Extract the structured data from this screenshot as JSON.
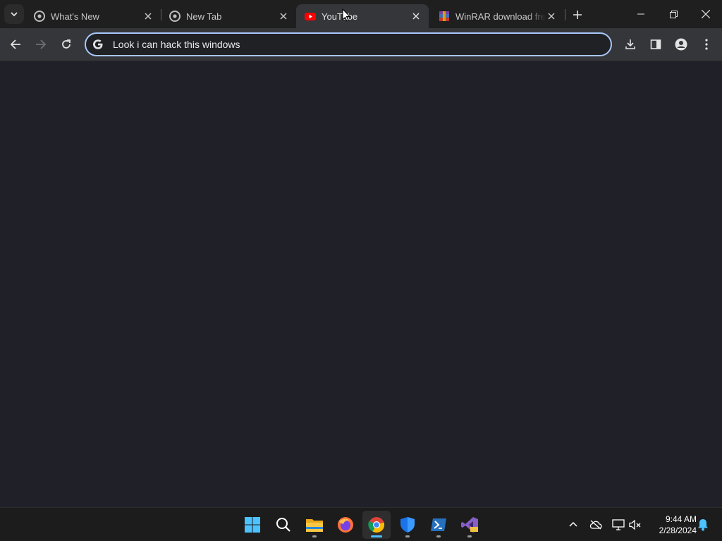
{
  "browser": {
    "tabs": [
      {
        "title": "What's New",
        "icon": "chrome-icon"
      },
      {
        "title": "New Tab",
        "icon": "chrome-icon"
      },
      {
        "title": "YouTube",
        "icon": "youtube-icon",
        "active": true
      },
      {
        "title": "WinRAR download fre",
        "icon": "winrar-icon"
      }
    ],
    "omnibox": {
      "value": "Look i can hack this windows"
    },
    "accent_color": "#a8c7fa",
    "content_background": "#1f2028"
  },
  "taskbar": {
    "apps": [
      "windows-start-icon",
      "search-icon",
      "file-explorer-icon",
      "firefox-icon",
      "chrome-icon",
      "windows-security-icon",
      "powershell-icon",
      "visual-studio-icon"
    ],
    "active_app": "chrome-icon",
    "clock": {
      "time": "9:44 AM",
      "date": "2/28/2024"
    }
  }
}
